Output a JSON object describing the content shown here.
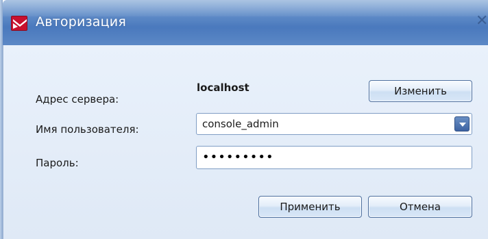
{
  "window": {
    "title": "Авторизация",
    "icon": "app-logo-icon",
    "close_glyph": "✕"
  },
  "form": {
    "server_label": "Адрес сервера:",
    "server_value": "localhost",
    "change_label": "Изменить",
    "user_label": "Имя пользователя:",
    "user_value": "console_admin",
    "password_label": "Пароль:",
    "password_value": "•••••••••"
  },
  "footer": {
    "apply_label": "Применить",
    "cancel_label": "Отмена"
  },
  "colors": {
    "titlebar": "#5f8bc7",
    "client_background": "#e9f1fb",
    "button_border": "#4e6f9e",
    "app_icon": "#c8102e"
  }
}
